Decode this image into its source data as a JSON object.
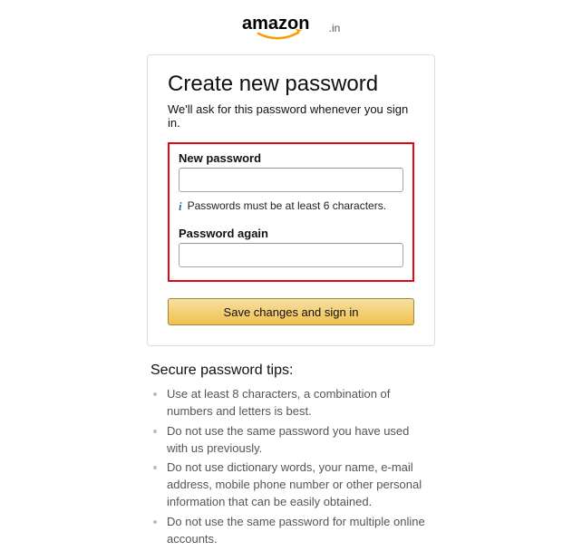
{
  "logo": {
    "brand": "amazon",
    "suffix": ".in"
  },
  "card": {
    "title": "Create new password",
    "subtitle": "We'll ask for this password whenever you sign in.",
    "new_password_label": "New password",
    "password_hint": "Passwords must be at least 6 characters.",
    "password_again_label": "Password again",
    "submit_label": "Save changes and sign in"
  },
  "tips": {
    "heading": "Secure password tips:",
    "items": [
      "Use at least 8 characters, a combination of numbers and letters is best.",
      "Do not use the same password you have used with us previously.",
      "Do not use dictionary words, your name, e-mail address, mobile phone number or other personal information that can be easily obtained.",
      "Do not use the same password for multiple online accounts."
    ]
  }
}
